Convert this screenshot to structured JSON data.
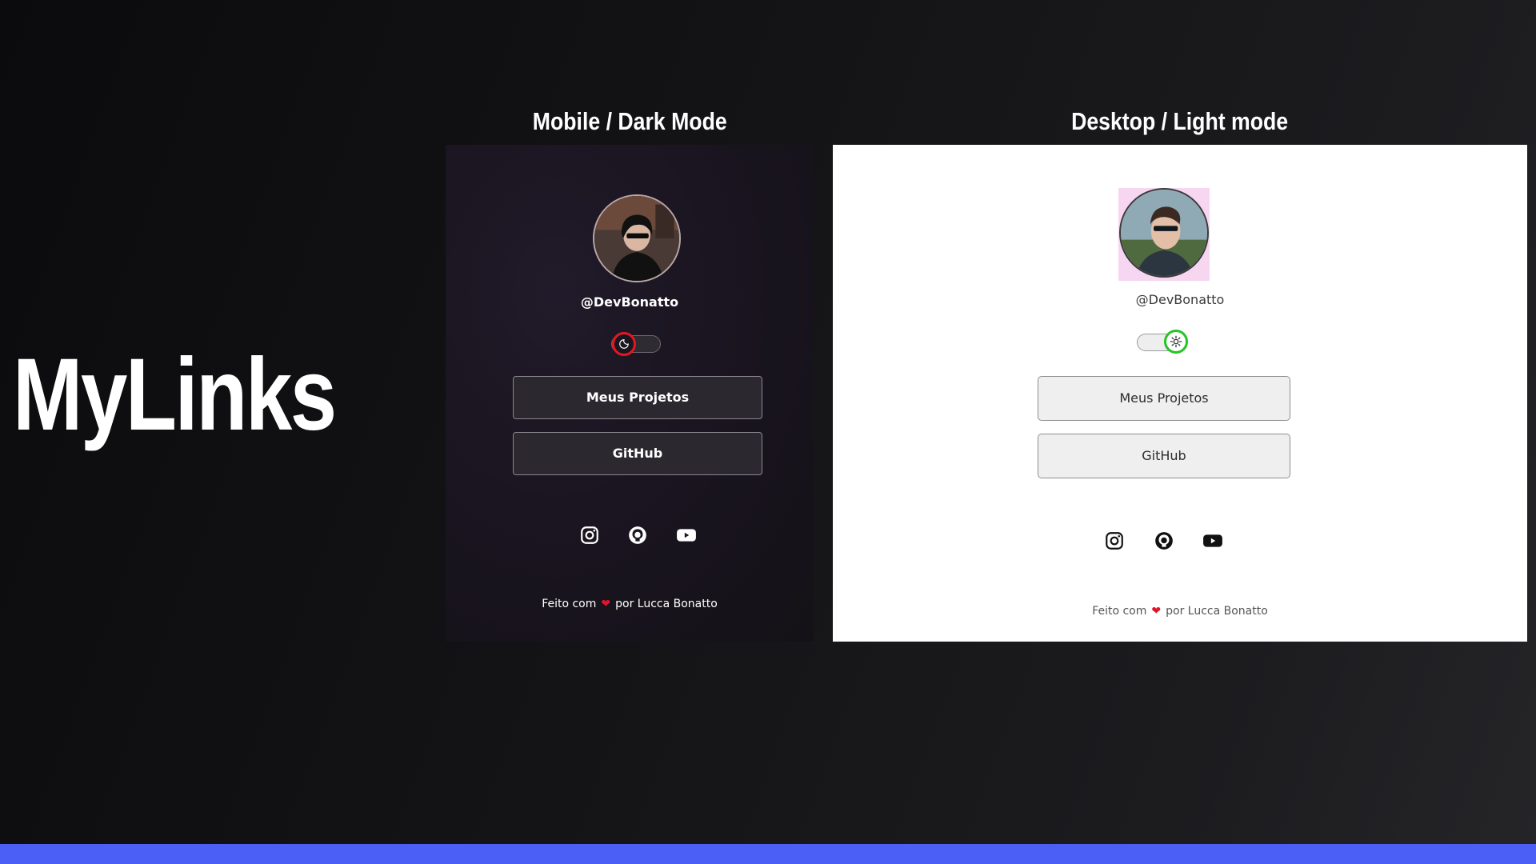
{
  "hero": {
    "title": "MyLinks"
  },
  "captions": {
    "mobile": "Mobile / Dark Mode",
    "desktop": "Desktop / Light mode"
  },
  "dark_panel": {
    "handle": "@DevBonatto",
    "toggle_icon": "moon-icon",
    "buttons": [
      {
        "label": "Meus Projetos"
      },
      {
        "label": "GitHub"
      }
    ],
    "social": [
      "instagram-icon",
      "github-icon",
      "youtube-icon"
    ],
    "footer": {
      "prefix": "Feito com",
      "heart": "❤",
      "suffix": "por Lucca Bonatto"
    }
  },
  "light_panel": {
    "handle": "@DevBonatto",
    "toggle_icon": "sun-icon",
    "buttons": [
      {
        "label": "Meus Projetos"
      },
      {
        "label": "GitHub"
      }
    ],
    "social": [
      "instagram-icon",
      "github-icon",
      "youtube-icon"
    ],
    "footer": {
      "prefix": "Feito com",
      "heart": "❤",
      "suffix": "por Lucca Bonatto"
    }
  },
  "colors": {
    "accent_bar": "#4b5ff6",
    "dark_toggle_ring": "#e5161f",
    "light_toggle_ring": "#22c522",
    "heart": "#e0142b"
  }
}
